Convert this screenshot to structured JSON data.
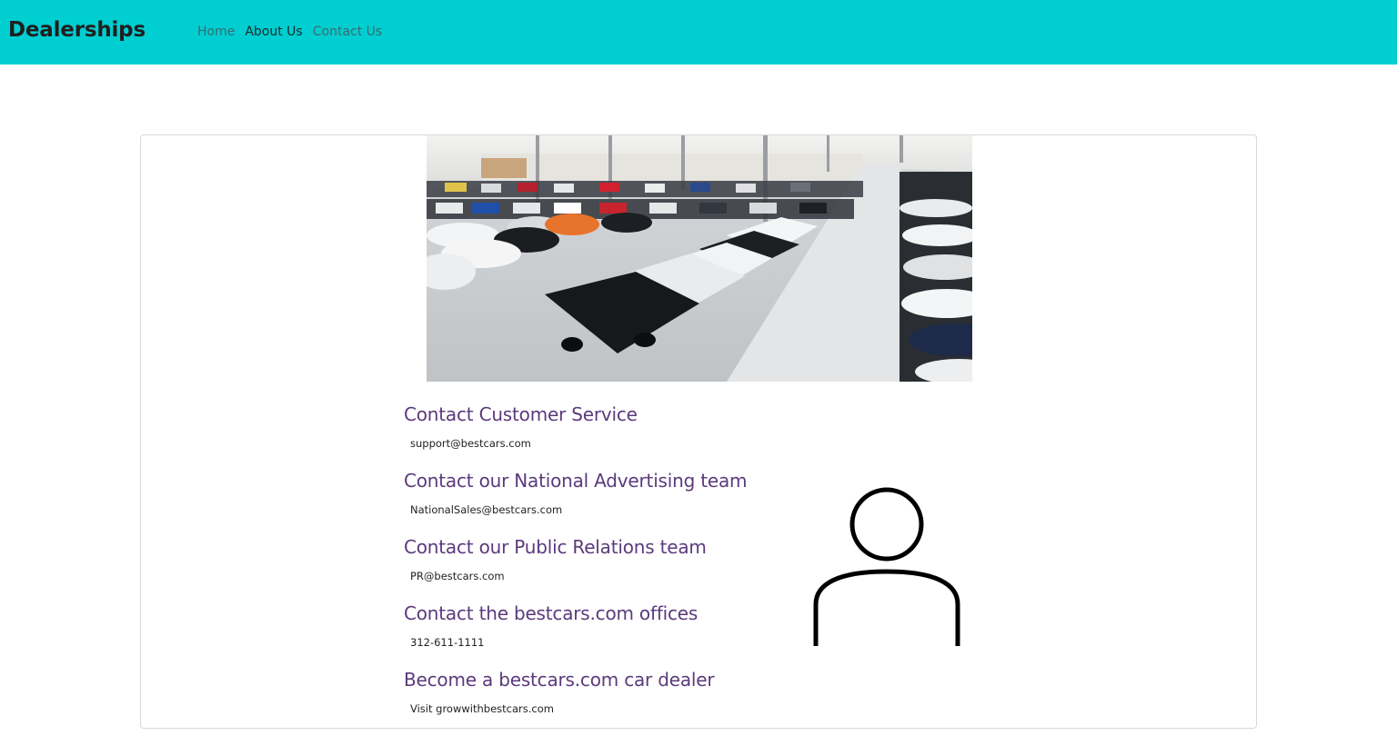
{
  "navbar": {
    "brand": "Dealerships",
    "links": [
      {
        "label": "Home"
      },
      {
        "label": "About Us"
      },
      {
        "label": "Contact Us"
      }
    ],
    "background": "#00ced1"
  },
  "hero_image": {
    "icon": "car-showroom-photo"
  },
  "contacts": [
    {
      "heading": "Contact Customer Service",
      "value": "support@bestcars.com"
    },
    {
      "heading": "Contact our National Advertising team",
      "value": "NationalSales@bestcars.com"
    },
    {
      "heading": "Contact our Public Relations team",
      "value": "PR@bestcars.com"
    },
    {
      "heading": "Contact the bestcars.com offices",
      "value": "312-611-1111"
    },
    {
      "heading": "Become a bestcars.com car dealer",
      "value": "Visit growwithbestcars.com"
    }
  ],
  "colors": {
    "heading": "#5b3a7c",
    "accent": "#00ced1"
  },
  "person_icon": "user-silhouette-icon"
}
